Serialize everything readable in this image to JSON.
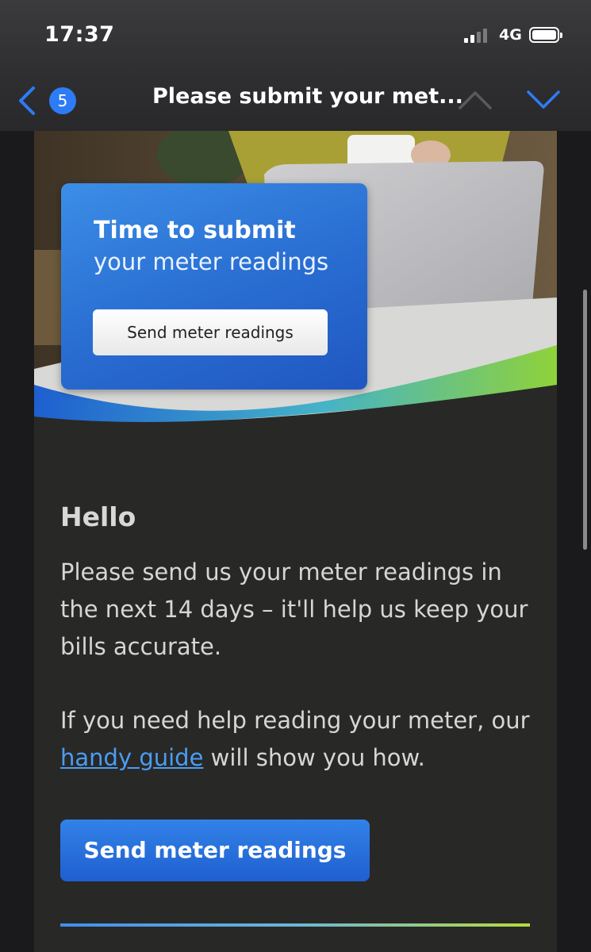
{
  "status_bar": {
    "time": "17:37",
    "network": "4G"
  },
  "nav": {
    "unread_count": "5",
    "title": "Please submit your met..."
  },
  "promo": {
    "title": "Time to submit",
    "subtitle": "your meter readings",
    "button_label": "Send meter readings"
  },
  "body": {
    "greeting": "Hello",
    "paragraph1": "Please send us your meter readings in the next 14 days – it'll help us keep your bills accurate.",
    "paragraph2_before": "If you need help reading your meter, our ",
    "paragraph2_link": "handy guide",
    "paragraph2_after": " will show you how.",
    "cta_label": "Send meter readings"
  },
  "colors": {
    "accent": "#2d7cf6",
    "link": "#4a9df3",
    "card_background": "#282826"
  }
}
